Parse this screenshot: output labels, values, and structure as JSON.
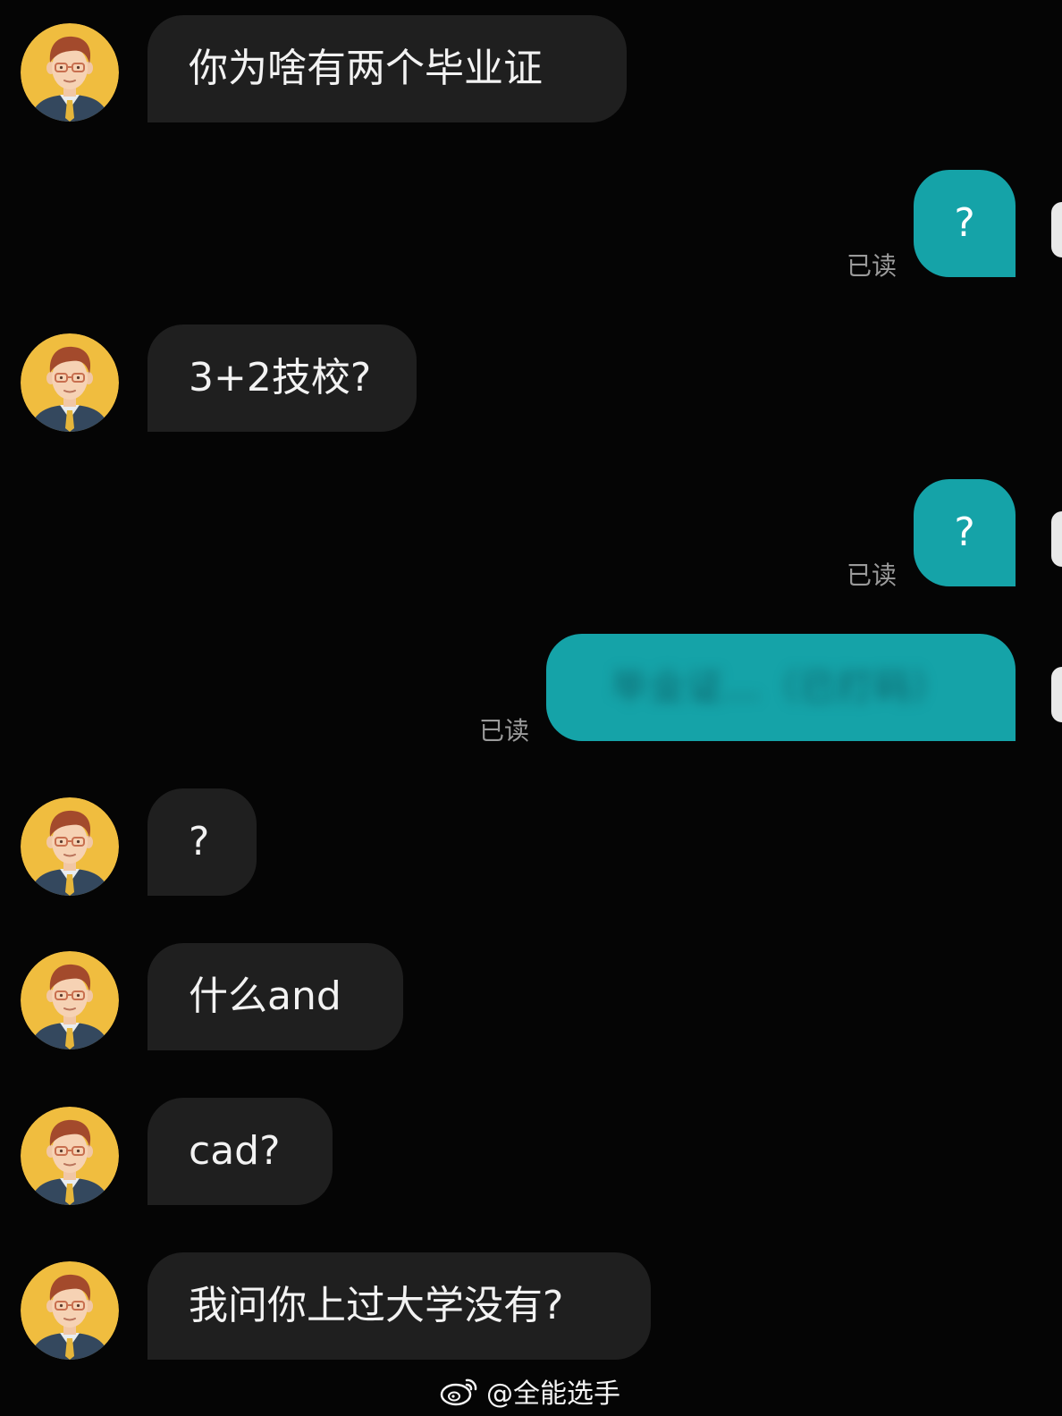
{
  "messages": [
    {
      "side": "in",
      "text": "你为啥有两个毕业证"
    },
    {
      "side": "out",
      "text": "?",
      "status": "已读"
    },
    {
      "side": "in",
      "text": "3+2技校?"
    },
    {
      "side": "out",
      "text": "?",
      "status": "已读"
    },
    {
      "side": "out",
      "text": "毕业证…（已打码）",
      "status": "已读",
      "blurred": true
    },
    {
      "side": "in",
      "text": "?"
    },
    {
      "side": "in",
      "text": "什么and"
    },
    {
      "side": "in",
      "text": "cad?"
    },
    {
      "side": "in",
      "text": "我问你上过大学没有?"
    }
  ],
  "watermark": {
    "icon": "weibo-icon",
    "text": "@全能选手"
  },
  "colors": {
    "background": "#050505",
    "incoming_bubble": "#1f1f1f",
    "outgoing_bubble": "#15a3a8",
    "read_status": "#9b9b9b"
  }
}
